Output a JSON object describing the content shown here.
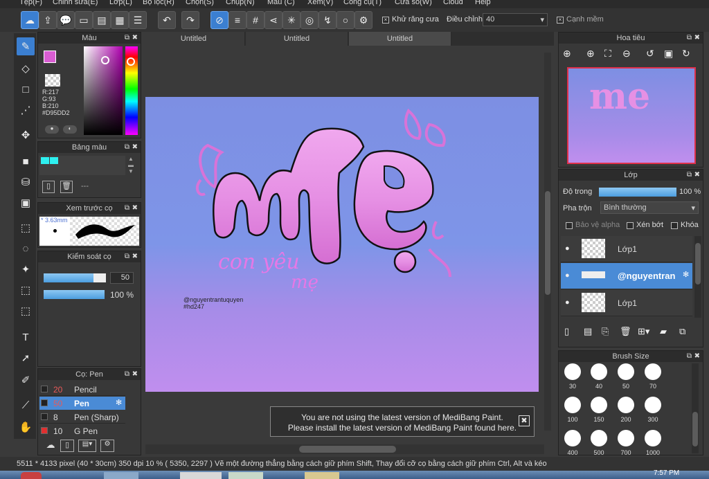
{
  "menu": [
    "Tệp(F)",
    "Chỉnh sửa(E)",
    "Lớp(L)",
    "Bộ lọc(R)",
    "Chọn(S)",
    "Chụp(N)",
    "Màu (C)",
    "Xem(V)",
    "Công cụ(T)",
    "Cửa sổ(W)",
    "Cloud",
    "Help"
  ],
  "toolbar": {
    "antialias_label": "Khử răng cưa",
    "adjust_label": "Điều chỉnh",
    "adjust_value": "40",
    "smooth_label": "Cạnh mềm"
  },
  "color_panel": {
    "title": "Màu",
    "r": "R:217",
    "g": "G:93",
    "b": "B:210",
    "hex": "#D95DD2",
    "main": "#d95dd2"
  },
  "palette_panel": {
    "title": "Bảng màu",
    "dash": "---"
  },
  "brush_preview": {
    "title": "Xem trước cọ",
    "size": "3.63mm"
  },
  "brush_control": {
    "title": "Kiểm soát cọ",
    "size_value": "50",
    "opacity_value": "100 %",
    "size_level": 0.8,
    "opacity_level": 1.0
  },
  "brush_list": {
    "title": "Cọ: Pen",
    "items": [
      {
        "size": "20",
        "name": "Pencil"
      },
      {
        "size": "50",
        "name": "Pen"
      },
      {
        "size": "8",
        "name": "Pen (Sharp)"
      },
      {
        "size": "10",
        "name": "G Pen"
      }
    ]
  },
  "tabs": [
    "Untitled",
    "Untitled",
    "Untitled"
  ],
  "artwork": {
    "main_text": "me",
    "sub1": "con yêu",
    "sub2": "mẹ",
    "credit1": "@nguyentrantuquyen",
    "credit2": "#hd247"
  },
  "navigator": {
    "title": "Hoa tiêu"
  },
  "layers": {
    "title": "Lớp",
    "opacity_label": "Độ trong",
    "opacity_value": "100 %",
    "opacity_level": 1.0,
    "blend_label": "Pha trộn",
    "blend_value": "Bình thường",
    "alpha_label": "Bảo vệ alpha",
    "clip_label": "Xén bớt",
    "lock_label": "Khóa",
    "items": [
      {
        "name": "Lớp1"
      },
      {
        "name": "@nguyentran"
      },
      {
        "name": "Lớp1"
      }
    ]
  },
  "brush_size": {
    "title": "Brush Size",
    "sizes": [
      "30",
      "40",
      "50",
      "70",
      "100",
      "150",
      "200",
      "300",
      "400",
      "500",
      "700",
      "1000"
    ]
  },
  "notice": {
    "line1": "You are not using the latest version of MediBang Paint.",
    "line2": "Please install the latest version of MediBang Paint found here."
  },
  "status": {
    "text": "5511 * 4133 pixel  (40 * 30cm)  350 dpi  10 %  ( 5350, 2297 )  Vẽ một đường thẳng bằng cách giữ phím Shift, Thay đổi cỡ cọ bằng cách giữ phím Ctrl, Alt và kéo"
  },
  "clock": "7:57 PM"
}
